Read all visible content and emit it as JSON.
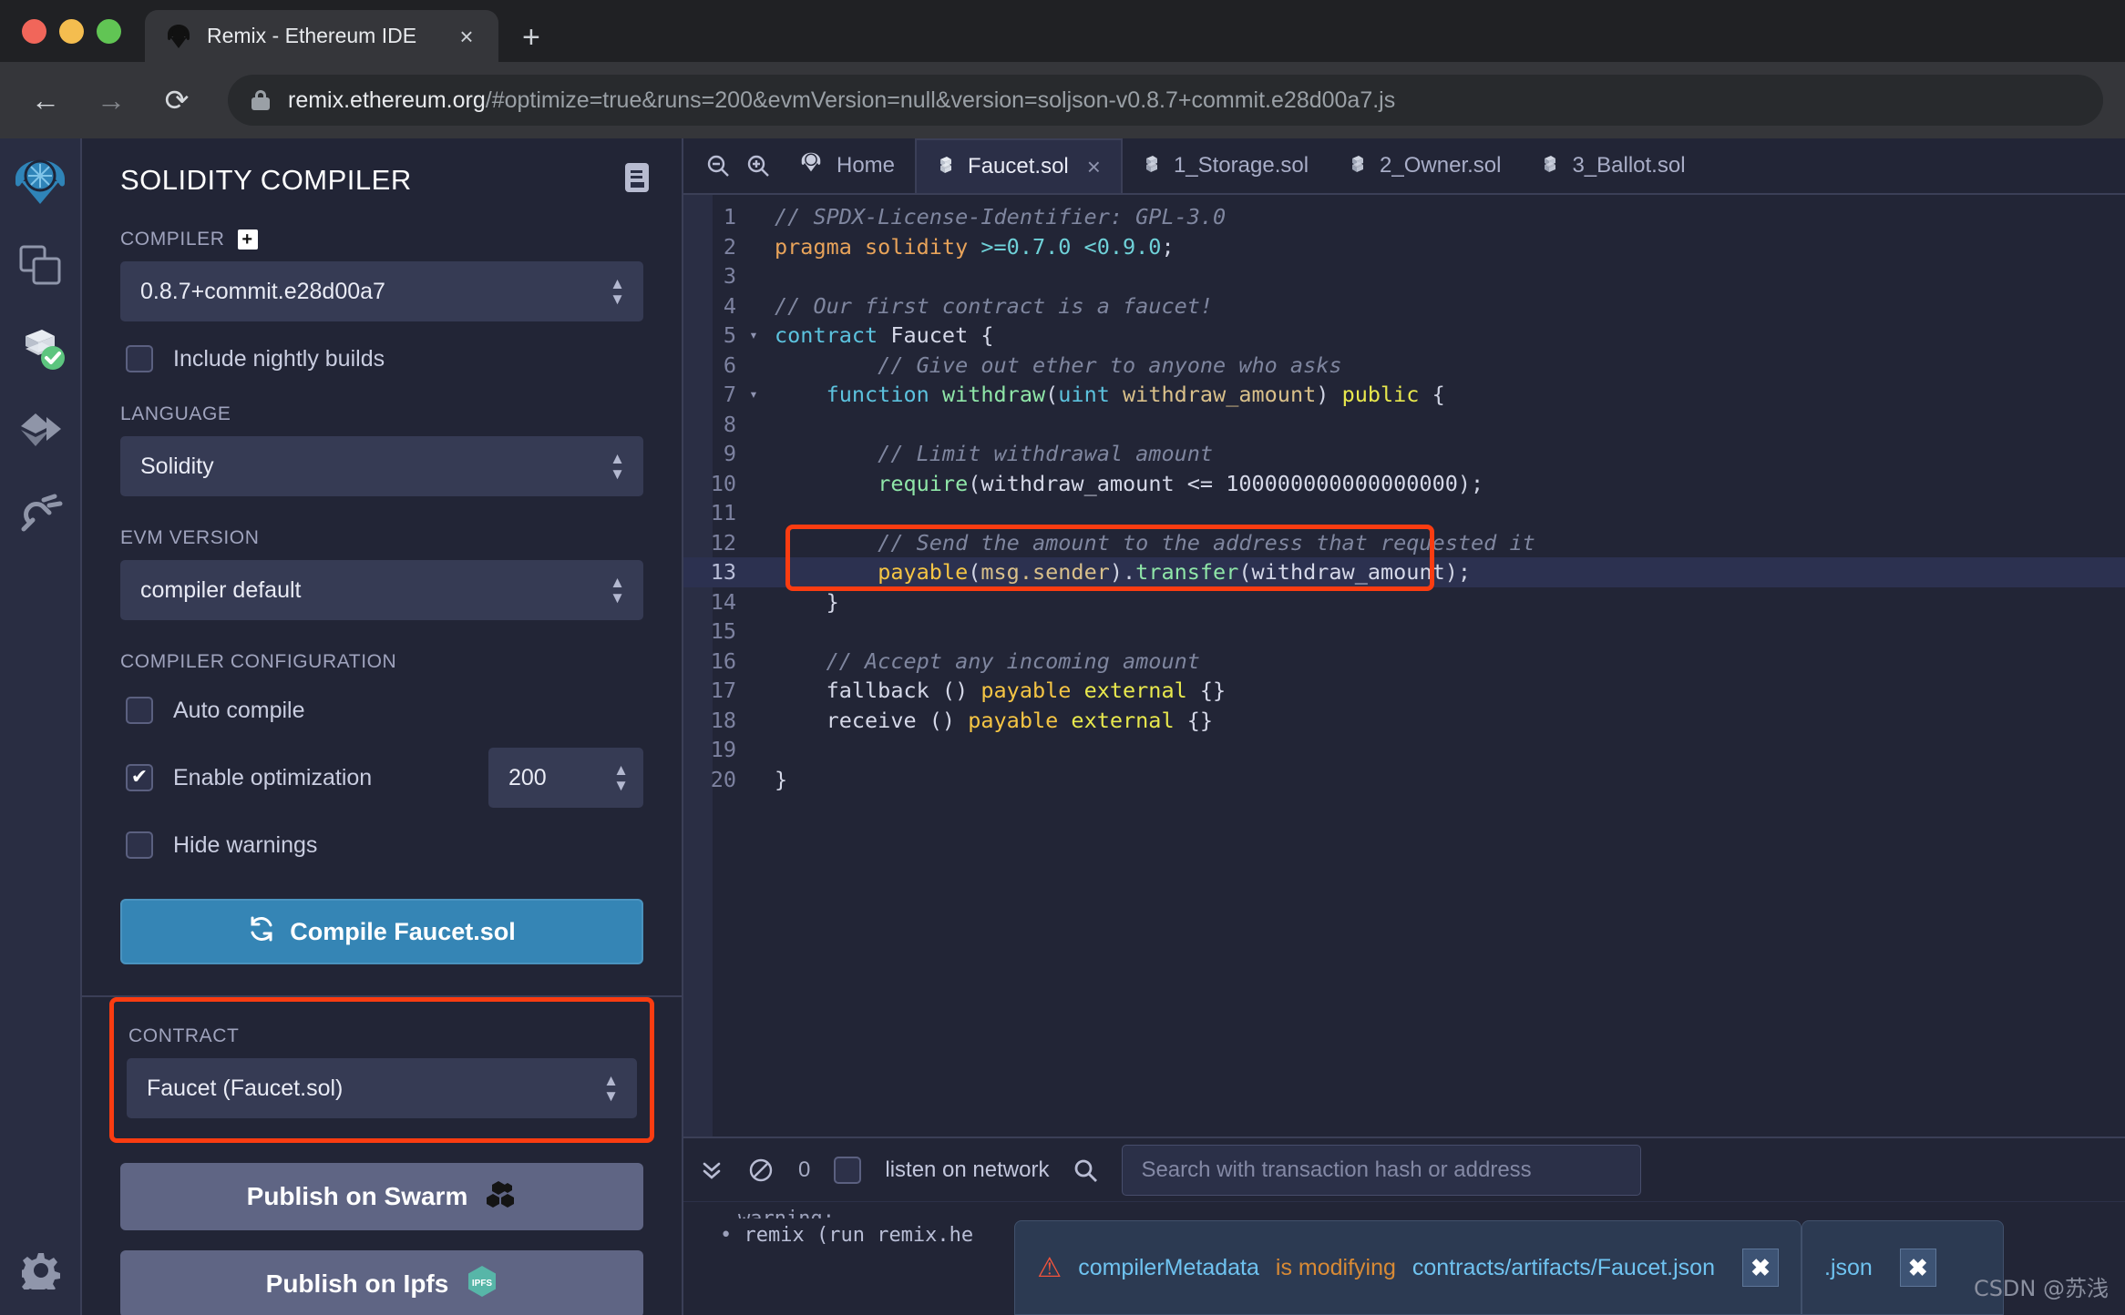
{
  "browser": {
    "tab": {
      "title": "Remix - Ethereum IDE",
      "favicon": "remix-logo-icon",
      "close": "×"
    },
    "newtab_label": "+",
    "nav": {
      "back": "←",
      "forward": "→",
      "reload": "⟳"
    },
    "url": {
      "host": "remix.ethereum.org",
      "rest": "/#optimize=true&runs=200&evmVersion=null&version=soljson-v0.8.7+commit.e28d00a7.js"
    }
  },
  "rail": {
    "items": [
      {
        "name": "remix-logo",
        "label": "Remix"
      },
      {
        "name": "file-explorer",
        "label": "File explorers"
      },
      {
        "name": "solidity-compiler",
        "label": "Solidity compiler",
        "badge": "check"
      },
      {
        "name": "deploy-run",
        "label": "Deploy & run transactions"
      },
      {
        "name": "plugin-manager",
        "label": "Plugin manager"
      }
    ],
    "settings_label": "Settings"
  },
  "panel": {
    "title": "SOLIDITY COMPILER",
    "doc_icon": "book-icon",
    "compiler_label": "COMPILER",
    "compiler_plus": "+",
    "compiler_value": "0.8.7+commit.e28d00a7",
    "nightly_label": "Include nightly builds",
    "nightly_checked": false,
    "language_label": "LANGUAGE",
    "language_value": "Solidity",
    "evm_label": "EVM VERSION",
    "evm_value": "compiler default",
    "config_label": "COMPILER CONFIGURATION",
    "auto_compile_label": "Auto compile",
    "auto_compile_checked": false,
    "optimization_label": "Enable optimization",
    "optimization_checked": true,
    "optimization_runs": "200",
    "hide_warnings_label": "Hide warnings",
    "hide_warnings_checked": false,
    "compile_button": "Compile Faucet.sol",
    "contract_label": "CONTRACT",
    "contract_value": "Faucet (Faucet.sol)",
    "publish_swarm": "Publish on Swarm",
    "publish_ipfs": "Publish on Ipfs",
    "ipfs_badge": "IPFS"
  },
  "editor_tabs": {
    "zoom_out": "zoom-out-icon",
    "zoom_in": "zoom-in-icon",
    "home": "Home",
    "tabs": [
      {
        "label": "Faucet.sol",
        "active": true,
        "closable": true
      },
      {
        "label": "1_Storage.sol",
        "active": false,
        "closable": false
      },
      {
        "label": "2_Owner.sol",
        "active": false,
        "closable": false
      },
      {
        "label": "3_Ballot.sol",
        "active": false,
        "closable": false
      }
    ],
    "close_glyph": "×"
  },
  "code": {
    "active_line": 13,
    "lines": [
      {
        "n": 1,
        "fold": "",
        "tokens": [
          {
            "t": "cmt",
            "v": "// SPDX-License-Identifier: GPL-3.0"
          }
        ]
      },
      {
        "n": 2,
        "fold": "",
        "tokens": [
          {
            "t": "kw",
            "v": "pragma solidity "
          },
          {
            "t": "num",
            "v": ">=0.7.0 <0.9.0"
          },
          {
            "t": "punct",
            "v": ";"
          }
        ]
      },
      {
        "n": 3,
        "fold": "",
        "tokens": [
          {
            "t": "plain",
            "v": ""
          }
        ]
      },
      {
        "n": 4,
        "fold": "",
        "tokens": [
          {
            "t": "cmt",
            "v": "// Our first contract is a faucet!"
          }
        ]
      },
      {
        "n": 5,
        "fold": "▾",
        "tokens": [
          {
            "t": "type",
            "v": "contract "
          },
          {
            "t": "plain",
            "v": "Faucet {"
          }
        ]
      },
      {
        "n": 6,
        "fold": "",
        "tokens": [
          {
            "t": "cmt",
            "v": "        // Give out ether to anyone who asks"
          }
        ]
      },
      {
        "n": 7,
        "fold": "▾",
        "tokens": [
          {
            "t": "type",
            "v": "    function "
          },
          {
            "t": "fn",
            "v": "withdraw"
          },
          {
            "t": "punct",
            "v": "("
          },
          {
            "t": "type",
            "v": "uint "
          },
          {
            "t": "par",
            "v": "withdraw_amount"
          },
          {
            "t": "punct",
            "v": ") "
          },
          {
            "t": "vis",
            "v": "public"
          },
          {
            "t": "punct",
            "v": " {"
          }
        ]
      },
      {
        "n": 8,
        "fold": "",
        "tokens": [
          {
            "t": "plain",
            "v": ""
          }
        ]
      },
      {
        "n": 9,
        "fold": "",
        "tokens": [
          {
            "t": "cmt",
            "v": "        // Limit withdrawal amount"
          }
        ]
      },
      {
        "n": 10,
        "fold": "",
        "tokens": [
          {
            "t": "plain",
            "v": "        "
          },
          {
            "t": "fn",
            "v": "require"
          },
          {
            "t": "punct",
            "v": "("
          },
          {
            "t": "plain",
            "v": "withdraw_amount <= 100000000000000000"
          },
          {
            "t": "punct",
            "v": ");"
          }
        ]
      },
      {
        "n": 11,
        "fold": "",
        "tokens": [
          {
            "t": "plain",
            "v": ""
          }
        ]
      },
      {
        "n": 12,
        "fold": "",
        "tokens": [
          {
            "t": "cmt",
            "v": "        // Send the amount to the address that requested it"
          }
        ]
      },
      {
        "n": 13,
        "fold": "",
        "tokens": [
          {
            "t": "plain",
            "v": "        "
          },
          {
            "t": "pay",
            "v": "payable"
          },
          {
            "t": "punct",
            "v": "("
          },
          {
            "t": "par",
            "v": "msg.sender"
          },
          {
            "t": "punct",
            "v": ")."
          },
          {
            "t": "fn",
            "v": "transfer"
          },
          {
            "t": "punct",
            "v": "("
          },
          {
            "t": "plain",
            "v": "withdraw_amount"
          },
          {
            "t": "punct",
            "v": ");"
          }
        ]
      },
      {
        "n": 14,
        "fold": "",
        "tokens": [
          {
            "t": "plain",
            "v": "    }"
          }
        ]
      },
      {
        "n": 15,
        "fold": "",
        "tokens": [
          {
            "t": "plain",
            "v": ""
          }
        ]
      },
      {
        "n": 16,
        "fold": "",
        "tokens": [
          {
            "t": "cmt",
            "v": "    // Accept any incoming amount"
          }
        ]
      },
      {
        "n": 17,
        "fold": "",
        "tokens": [
          {
            "t": "plain",
            "v": "    fallback () "
          },
          {
            "t": "pay",
            "v": "payable "
          },
          {
            "t": "vis",
            "v": "external"
          },
          {
            "t": "plain",
            "v": " {}"
          }
        ]
      },
      {
        "n": 18,
        "fold": "",
        "tokens": [
          {
            "t": "plain",
            "v": "    receive () "
          },
          {
            "t": "pay",
            "v": "payable "
          },
          {
            "t": "vis",
            "v": "external"
          },
          {
            "t": "plain",
            "v": " {}"
          }
        ]
      },
      {
        "n": 19,
        "fold": "",
        "tokens": [
          {
            "t": "plain",
            "v": ""
          }
        ]
      },
      {
        "n": 20,
        "fold": "",
        "tokens": [
          {
            "t": "plain",
            "v": "}"
          }
        ]
      }
    ]
  },
  "terminal": {
    "collapse_icon": "chevron-double-down-icon",
    "clear_icon": "no-entry-icon",
    "pending_count": "0",
    "listen_label": "listen on network",
    "listen_checked": false,
    "search_icon": "search-icon",
    "search_placeholder": "Search with transaction hash or address",
    "log_warning": "warning:",
    "log_line": "remix (run remix.he"
  },
  "toasts": [
    {
      "icon": "warning-triangle-icon",
      "part_a": "compilerMetadata",
      "part_b": " is modifying",
      "part_c": "contracts/artifacts/Faucet.json",
      "close": "✖"
    },
    {
      "icon": "",
      "part_a": "",
      "part_b": "",
      "part_c": ".json",
      "close": "✖"
    }
  ],
  "watermark": "CSDN @苏浅",
  "colors": {
    "accent_blue": "#3585b5",
    "highlight_red": "#fa3c11",
    "panel_bg": "#222536",
    "rail_bg": "#292d42",
    "input_bg": "#363b54",
    "publish_btn": "#5f6584",
    "toast_bg": "#2c3a52"
  }
}
